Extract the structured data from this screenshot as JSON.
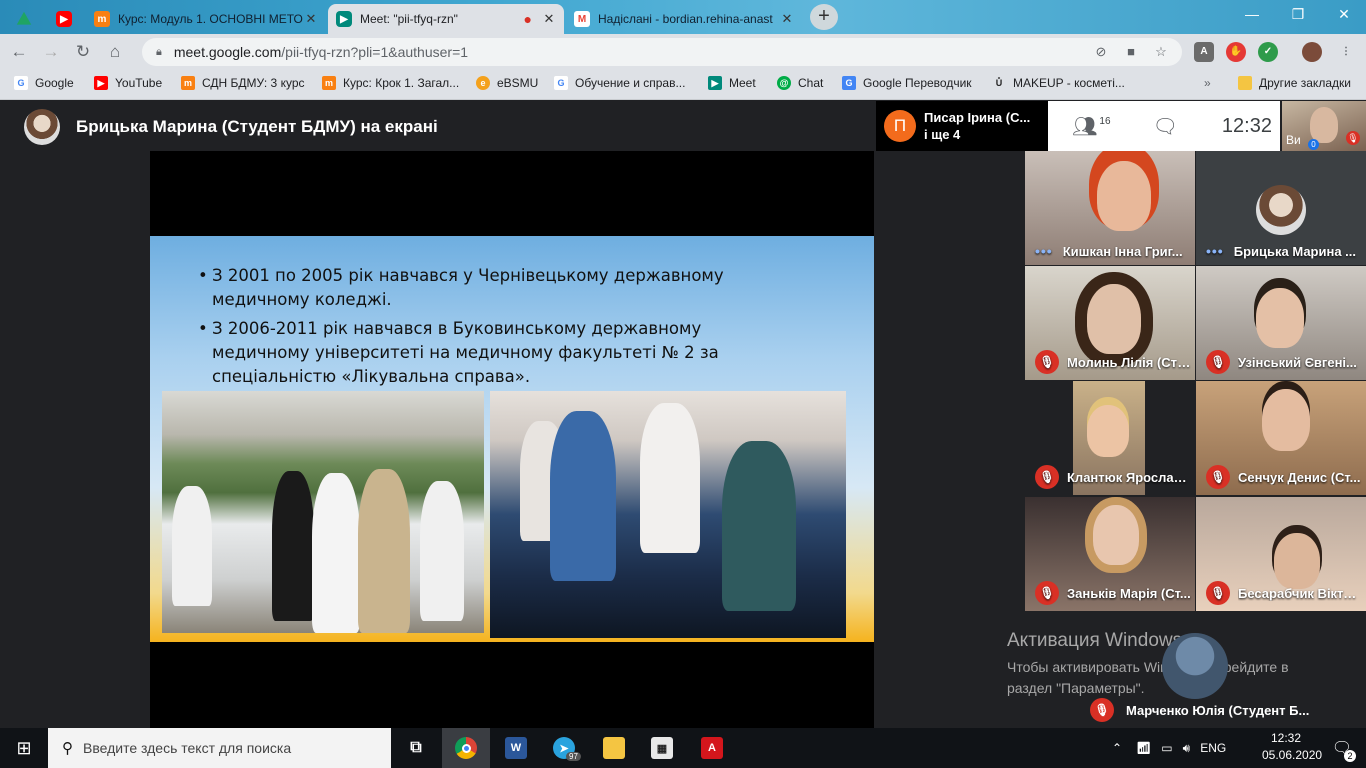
{
  "tabs": [
    {
      "title": "",
      "icon": "google-drive-icon",
      "color": "#1fa463"
    },
    {
      "title": "",
      "icon": "youtube-icon",
      "color": "#ff0000"
    },
    {
      "title": "Курс: Модуль 1. ОСНОВНІ МЕТО",
      "icon": "moodle-icon",
      "color": "#f98012"
    },
    {
      "title": "Meet: \"pii-tfyq-rzn\"",
      "icon": "meet-icon",
      "color": "#00897b",
      "recording": "●"
    },
    {
      "title": "Надіслані - bordian.rehina-anast",
      "icon": "gmail-icon",
      "color": "#ea4335"
    }
  ],
  "new_tab": "+",
  "window_controls": {
    "minimize": "—",
    "restore": "❐",
    "close": "✕"
  },
  "address": {
    "host": "meet.google.com",
    "path": "/pii-tfyq-rzn?pli=1&authuser=1"
  },
  "bookmarks": [
    {
      "label": "Google",
      "icon": "google-icon",
      "color": "#4285f4",
      "glyph": "G"
    },
    {
      "label": "YouTube",
      "icon": "youtube-icon",
      "color": "#ff0000",
      "glyph": "▶"
    },
    {
      "label": "СДН БДМУ: 3 курс",
      "icon": "moodle-icon",
      "color": "#f98012",
      "glyph": "m"
    },
    {
      "label": "Курс: Крок 1. Загал...",
      "icon": "moodle-icon",
      "color": "#f98012",
      "glyph": "m"
    },
    {
      "label": "eBSMU",
      "icon": "ebsmu-icon",
      "color": "#f4a11c",
      "glyph": "e"
    },
    {
      "label": "Обучение и справ...",
      "icon": "google-icon",
      "color": "#4285f4",
      "glyph": "G"
    },
    {
      "label": "Meet",
      "icon": "meet-icon",
      "color": "#00897b",
      "glyph": "▶"
    },
    {
      "label": "Chat",
      "icon": "chat-icon",
      "color": "#00ac47",
      "glyph": "@"
    },
    {
      "label": "Google Переводчик",
      "icon": "translate-icon",
      "color": "#4285f4",
      "glyph": "G"
    },
    {
      "label": "MAKEUP - косметі...",
      "icon": "makeup-icon",
      "color": "#222222",
      "glyph": "Ů"
    }
  ],
  "bookmarks_more": "»",
  "bookmarks_other": "Другие закладки",
  "presenter": {
    "label": "Брицька Марина (Студент БДМУ) на екрані"
  },
  "owner": {
    "initial": "П",
    "name": "Писар Ірина (С...",
    "others": "і ще 4"
  },
  "participants_count": "16",
  "time": "12:32",
  "self_label": "Ви",
  "self_badge": "0",
  "slide": {
    "bullets": [
      "З 2001 по 2005 рік навчався у Чернівецькому державному медичному коледжі.",
      "З 2006-2011 рік навчався в Буковинському державному медичному університеті на медичному факультеті № 2 за спеціальністю «Лікувальна справа»."
    ]
  },
  "tiles": [
    {
      "name": "Кишкан Інна Григ...",
      "status": "speaking"
    },
    {
      "name": "Брицька Марина ...",
      "status": "speaking"
    },
    {
      "name": "Молинь Лілія (Сту...",
      "status": "muted"
    },
    {
      "name": "Узінський Євгені...",
      "status": "muted"
    },
    {
      "name": "Клантюк Ярослав...",
      "status": "muted"
    },
    {
      "name": "Сенчук Денис (Ст...",
      "status": "muted"
    },
    {
      "name": "Заньків Марія (Ст...",
      "status": "muted"
    },
    {
      "name": "Бесарабчик Вікто...",
      "status": "muted"
    }
  ],
  "bottom_user": {
    "name": "Марченко Юлія (Студент Б..."
  },
  "windows_activation": {
    "title": "Активация Windows",
    "line1": "Чтобы активировать Windows, перейдите в",
    "line2": "раздел \"Параметры\"."
  },
  "taskbar": {
    "search_placeholder": "Введите здесь текст для поиска",
    "telegram_badge": "97",
    "lang": "ENG",
    "clock_time": "12:32",
    "clock_date": "05.06.2020",
    "notifications": "2"
  }
}
